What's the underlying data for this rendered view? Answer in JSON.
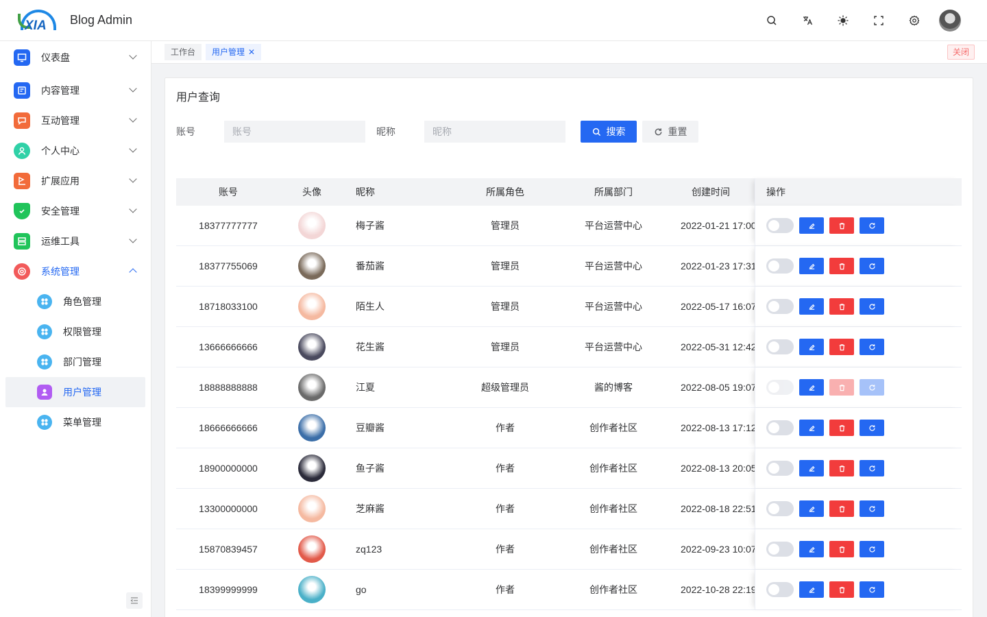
{
  "app": {
    "logo_text": "XIA",
    "title": "Blog Admin"
  },
  "header": {
    "icons": [
      "search-icon",
      "translate-icon",
      "theme-icon",
      "fullscreen-icon",
      "settings-icon"
    ]
  },
  "sidebar": {
    "items": [
      {
        "label": "仪表盘",
        "icon": "dashboard-icon",
        "color": "#2468f2"
      },
      {
        "label": "内容管理",
        "icon": "content-icon",
        "color": "#2468f2"
      },
      {
        "label": "互动管理",
        "icon": "chat-icon",
        "color": "#f26b3a"
      },
      {
        "label": "个人中心",
        "icon": "user-icon",
        "color": "#2fd1a7"
      },
      {
        "label": "扩展应用",
        "icon": "extension-icon",
        "color": "#f26b3a"
      },
      {
        "label": "安全管理",
        "icon": "shield-icon",
        "color": "#20c45a"
      },
      {
        "label": "运维工具",
        "icon": "tools-icon",
        "color": "#20c45a"
      },
      {
        "label": "系统管理",
        "icon": "system-icon",
        "color": "#f25a5a"
      }
    ],
    "sub_items": [
      {
        "label": "角色管理"
      },
      {
        "label": "权限管理"
      },
      {
        "label": "部门管理"
      },
      {
        "label": "用户管理"
      },
      {
        "label": "菜单管理"
      }
    ]
  },
  "tabs": {
    "items": [
      "工作台",
      "用户管理"
    ],
    "close_all": "关闭"
  },
  "query": {
    "title": "用户查询",
    "account_label": "账号",
    "account_placeholder": "账号",
    "nickname_label": "昵称",
    "nickname_placeholder": "昵称",
    "search_label": "搜索",
    "reset_label": "重置"
  },
  "table": {
    "headers": {
      "account": "账号",
      "avatar": "头像",
      "nickname": "昵称",
      "role": "所属角色",
      "dept": "所属部门",
      "created": "创建时间",
      "ops": "操作"
    },
    "rows": [
      {
        "account": "18377777777",
        "nickname": "梅子酱",
        "role": "管理员",
        "dept": "平台运营中心",
        "created": "2022-01-21 17:00",
        "avatar_color": "#f3d6d6",
        "disabled": false
      },
      {
        "account": "18377755069",
        "nickname": "番茄酱",
        "role": "管理员",
        "dept": "平台运营中心",
        "created": "2022-01-23 17:31",
        "avatar_color": "#7a6a5a",
        "disabled": false
      },
      {
        "account": "18718033100",
        "nickname": "陌生人",
        "role": "管理员",
        "dept": "平台运营中心",
        "created": "2022-05-17 16:07",
        "avatar_color": "#f5b9a0",
        "disabled": false
      },
      {
        "account": "13666666666",
        "nickname": "花生酱",
        "role": "管理员",
        "dept": "平台运营中心",
        "created": "2022-05-31 12:42",
        "avatar_color": "#4a4a5e",
        "disabled": false
      },
      {
        "account": "18888888888",
        "nickname": "江夏",
        "role": "超级管理员",
        "dept": "酱的博客",
        "created": "2022-08-05 19:07",
        "avatar_color": "#6a6a6a",
        "disabled": true
      },
      {
        "account": "18666666666",
        "nickname": "豆瓣酱",
        "role": "作者",
        "dept": "创作者社区",
        "created": "2022-08-13 17:12",
        "avatar_color": "#3b6ea8",
        "disabled": false
      },
      {
        "account": "18900000000",
        "nickname": "鱼子酱",
        "role": "作者",
        "dept": "创作者社区",
        "created": "2022-08-13 20:05",
        "avatar_color": "#2b2b3a",
        "disabled": false
      },
      {
        "account": "13300000000",
        "nickname": "芝麻酱",
        "role": "作者",
        "dept": "创作者社区",
        "created": "2022-08-18 22:51",
        "avatar_color": "#f5b9a0",
        "disabled": false
      },
      {
        "account": "15870839457",
        "nickname": "zq123",
        "role": "作者",
        "dept": "创作者社区",
        "created": "2022-09-23 10:07",
        "avatar_color": "#e25a4a",
        "disabled": false
      },
      {
        "account": "18399999999",
        "nickname": "go",
        "role": "作者",
        "dept": "创作者社区",
        "created": "2022-10-28 22:19",
        "avatar_color": "#4ab0c8",
        "disabled": false
      }
    ]
  }
}
